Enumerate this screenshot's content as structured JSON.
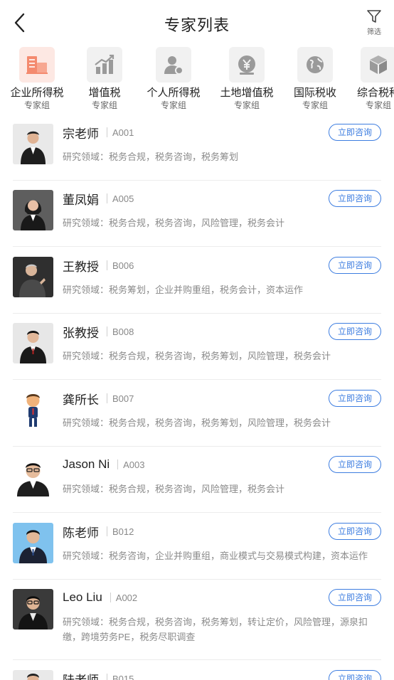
{
  "header": {
    "title": "专家列表",
    "filter_label": "筛选"
  },
  "categories": [
    {
      "name": "企业所得税",
      "sub": "专家组",
      "icon": "building-icon",
      "active": true
    },
    {
      "name": "增值税",
      "sub": "专家组",
      "icon": "chart-icon"
    },
    {
      "name": "个人所得税",
      "sub": "专家组",
      "icon": "person-icon"
    },
    {
      "name": "土地增值税",
      "sub": "专家组",
      "icon": "yen-coin-icon"
    },
    {
      "name": "国际税收",
      "sub": "专家组",
      "icon": "globe-icon"
    },
    {
      "name": "综合税种",
      "sub": "专家组",
      "icon": "box-icon"
    }
  ],
  "experts": [
    {
      "name": "宗老师",
      "code": "A001",
      "field": "研究领域：税务合规，税务咨询，税务筹划",
      "button": "立即咨询",
      "avatar_bg": "#e9e9e9"
    },
    {
      "name": "董凤娟",
      "code": "A005",
      "field": "研究领域：税务合规，税务咨询，风险管理，税务会计",
      "button": "立即咨询",
      "avatar_bg": "#5e5e5e"
    },
    {
      "name": "王教授",
      "code": "B006",
      "field": "研究领域：税务筹划，企业并购重组，税务会计，资本运作",
      "button": "立即咨询",
      "avatar_bg": "#2f2f2f"
    },
    {
      "name": "张教授",
      "code": "B008",
      "field": "研究领域：税务合规，税务咨询，税务筹划，风险管理，税务会计",
      "button": "立即咨询",
      "avatar_bg": "#e7e7e7"
    },
    {
      "name": "龚所长",
      "code": "B007",
      "field": "研究领域：税务合规，税务咨询，税务筹划，风险管理，税务会计",
      "button": "立即咨询",
      "avatar_bg": "#ffffff"
    },
    {
      "name": "Jason Ni",
      "code": "A003",
      "field": "研究领域：税务合规，税务咨询，风险管理，税务会计",
      "button": "立即咨询",
      "avatar_bg": "#ffffff"
    },
    {
      "name": "陈老师",
      "code": "B012",
      "field": "研究领域：税务咨询，企业并购重组，商业模式与交易模式构建，资本运作",
      "button": "立即咨询",
      "avatar_bg": "#7fc2ee"
    },
    {
      "name": "Leo Liu",
      "code": "A002",
      "field": "研究领域：税务合规，税务咨询，税务筹划，转让定价，风险管理，源泉扣缴，跨境劳务PE，税务尽职调查",
      "button": "立即咨询",
      "avatar_bg": "#3a3a3a"
    },
    {
      "name": "陆老师",
      "code": "B015",
      "field": "",
      "button": "立即咨询",
      "avatar_bg": "#e9e9e9"
    }
  ]
}
